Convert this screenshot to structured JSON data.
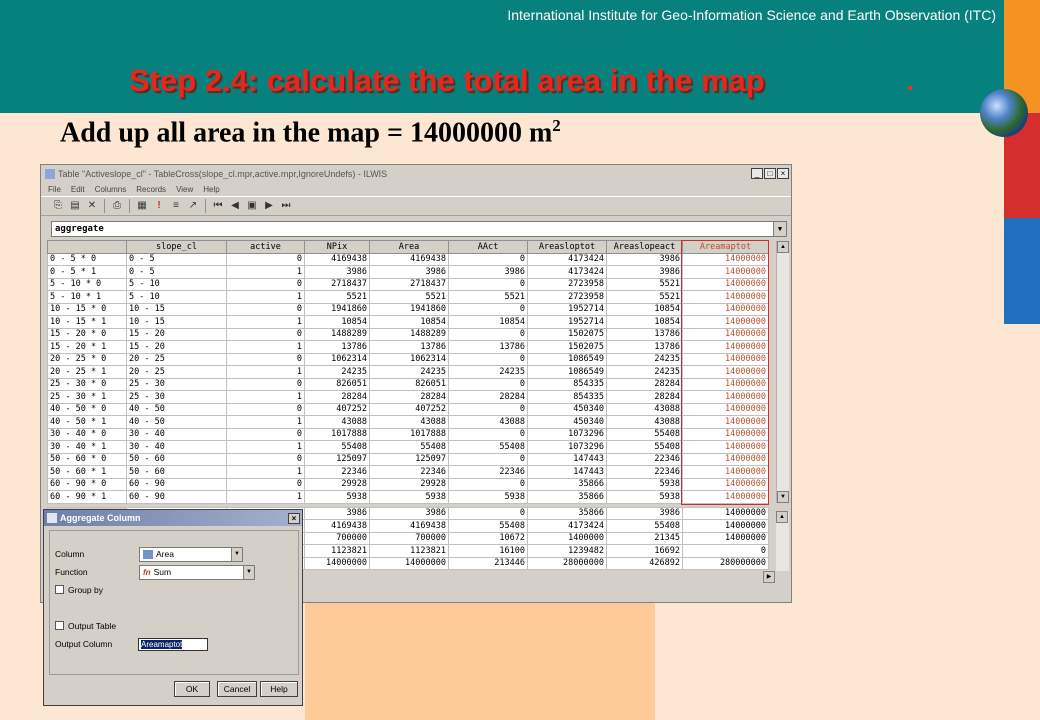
{
  "slide": {
    "institute": "International Institute for Geo-Information Science and Earth Observation (ITC)",
    "title": "Step 2.4: calculate the total area in the map",
    "subtitle_text": "Add up all area in the map = 14000000 m",
    "subtitle_sup": "2"
  },
  "table_window": {
    "title": "Table \"Activeslope_cl\" - TableCross(slope_cl.mpr,active.mpr,IgnoreUndefs) - ILWIS",
    "menu": [
      "File",
      "Edit",
      "Columns",
      "Records",
      "View",
      "Help"
    ],
    "command": "aggregate",
    "columns": [
      "slope_cl",
      "active",
      "NPix",
      "Area",
      "AAct",
      "Areasloptot",
      "Areaslopeact",
      "Areamaptot"
    ],
    "rows": [
      {
        "key": "0 - 5 * 0",
        "cells": [
          "0 - 5",
          "0",
          "4169438",
          "4169438",
          "0",
          "4173424",
          "3986",
          "14000000"
        ]
      },
      {
        "key": "0 - 5 * 1",
        "cells": [
          "0 - 5",
          "1",
          "3986",
          "3986",
          "3986",
          "4173424",
          "3986",
          "14000000"
        ]
      },
      {
        "key": "5 - 10 * 0",
        "cells": [
          "5 - 10",
          "0",
          "2718437",
          "2718437",
          "0",
          "2723958",
          "5521",
          "14000000"
        ]
      },
      {
        "key": "5 - 10 * 1",
        "cells": [
          "5 - 10",
          "1",
          "5521",
          "5521",
          "5521",
          "2723958",
          "5521",
          "14000000"
        ]
      },
      {
        "key": "10 - 15 * 0",
        "cells": [
          "10 - 15",
          "0",
          "1941860",
          "1941860",
          "0",
          "1952714",
          "10854",
          "14000000"
        ]
      },
      {
        "key": "10 - 15 * 1",
        "cells": [
          "10 - 15",
          "1",
          "10854",
          "10854",
          "10854",
          "1952714",
          "10854",
          "14000000"
        ]
      },
      {
        "key": "15 - 20 * 0",
        "cells": [
          "15 - 20",
          "0",
          "1488289",
          "1488289",
          "0",
          "1502075",
          "13786",
          "14000000"
        ]
      },
      {
        "key": "15 - 20 * 1",
        "cells": [
          "15 - 20",
          "1",
          "13786",
          "13786",
          "13786",
          "1502075",
          "13786",
          "14000000"
        ]
      },
      {
        "key": "20 - 25 * 0",
        "cells": [
          "20 - 25",
          "0",
          "1062314",
          "1062314",
          "0",
          "1086549",
          "24235",
          "14000000"
        ]
      },
      {
        "key": "20 - 25 * 1",
        "cells": [
          "20 - 25",
          "1",
          "24235",
          "24235",
          "24235",
          "1086549",
          "24235",
          "14000000"
        ]
      },
      {
        "key": "25 - 30 * 0",
        "cells": [
          "25 - 30",
          "0",
          "826051",
          "826051",
          "0",
          "854335",
          "28284",
          "14000000"
        ]
      },
      {
        "key": "25 - 30 * 1",
        "cells": [
          "25 - 30",
          "1",
          "28284",
          "28284",
          "28284",
          "854335",
          "28284",
          "14000000"
        ]
      },
      {
        "key": "40 - 50 * 0",
        "cells": [
          "40 - 50",
          "0",
          "407252",
          "407252",
          "0",
          "450340",
          "43088",
          "14000000"
        ]
      },
      {
        "key": "40 - 50 * 1",
        "cells": [
          "40 - 50",
          "1",
          "43088",
          "43088",
          "43088",
          "450340",
          "43088",
          "14000000"
        ]
      },
      {
        "key": "30 - 40 * 0",
        "cells": [
          "30 - 40",
          "0",
          "1017888",
          "1017888",
          "0",
          "1073296",
          "55408",
          "14000000"
        ]
      },
      {
        "key": "30 - 40 * 1",
        "cells": [
          "30 - 40",
          "1",
          "55408",
          "55408",
          "55408",
          "1073296",
          "55408",
          "14000000"
        ]
      },
      {
        "key": "50 - 60 * 0",
        "cells": [
          "50 - 60",
          "0",
          "125097",
          "125097",
          "0",
          "147443",
          "22346",
          "14000000"
        ]
      },
      {
        "key": "50 - 60 * 1",
        "cells": [
          "50 - 60",
          "1",
          "22346",
          "22346",
          "22346",
          "147443",
          "22346",
          "14000000"
        ]
      },
      {
        "key": "60 - 90 * 0",
        "cells": [
          "60 - 90",
          "0",
          "29928",
          "29928",
          "0",
          "35866",
          "5938",
          "14000000"
        ]
      },
      {
        "key": "60 - 90 * 1",
        "cells": [
          "60 - 90",
          "1",
          "5938",
          "5938",
          "5938",
          "35866",
          "5938",
          "14000000"
        ]
      }
    ],
    "stats": [
      [
        "3986",
        "3986",
        "0",
        "35866",
        "3986",
        "14000000"
      ],
      [
        "4169438",
        "4169438",
        "55408",
        "4173424",
        "55408",
        "14000000"
      ],
      [
        "700000",
        "700000",
        "10672",
        "1400000",
        "21345",
        "14000000"
      ],
      [
        "1123821",
        "1123821",
        "16100",
        "1239482",
        "16692",
        "0"
      ],
      [
        "14000000",
        "14000000",
        "213446",
        "28000000",
        "426892",
        "280000000"
      ]
    ]
  },
  "dialog": {
    "title": "Aggregate Column",
    "column_label": "Column",
    "column_value": "Area",
    "function_label": "Function",
    "function_prefix": "fn",
    "function_value": "Sum",
    "group_by_label": "Group by",
    "output_table_label": "Output Table",
    "output_column_label": "Output Column",
    "output_column_value": "Areamaptot",
    "ok": "OK",
    "cancel": "Cancel",
    "help": "Help"
  },
  "colors": {
    "header_teal": "#07817d",
    "title_red": "#e8261c",
    "highlight_box": "#d32b2b"
  }
}
